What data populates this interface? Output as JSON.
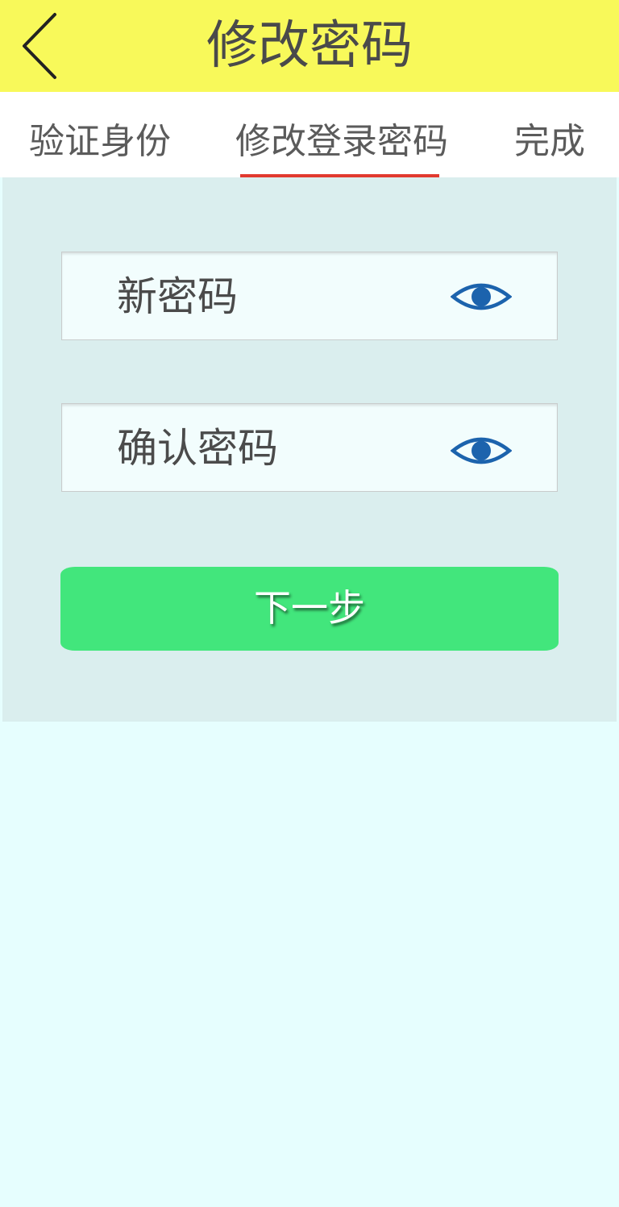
{
  "header": {
    "title": "修改密码",
    "back_icon": "chevron-left-icon"
  },
  "tabs": [
    {
      "label": "验证身份",
      "active": false
    },
    {
      "label": "修改登录密码",
      "active": true
    },
    {
      "label": "完成",
      "active": false
    }
  ],
  "form": {
    "new_password": {
      "label": "新密码",
      "icon": "eye-icon"
    },
    "confirm_password": {
      "label": "确认密码",
      "icon": "eye-icon"
    },
    "next_button": "下一步"
  },
  "colors": {
    "header_bg": "#f8f95a",
    "tab_indicator": "#e23a2f",
    "panel_bg": "#daeeee",
    "page_bg": "#e6fefe",
    "button_bg": "#42e67c",
    "eye_icon": "#1c63ad"
  }
}
